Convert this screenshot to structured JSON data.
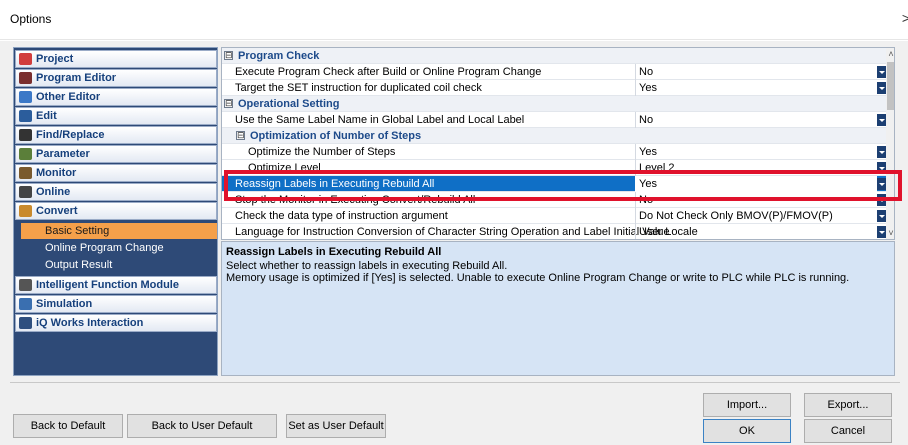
{
  "window": {
    "title": "Options",
    "close_glyph": ">"
  },
  "nav": {
    "items": [
      {
        "label": "Project",
        "icon": "project-icon",
        "color": "#d13d3d"
      },
      {
        "label": "Program Editor",
        "icon": "program-editor-icon",
        "color": "#7a2e2e"
      },
      {
        "label": "Other Editor",
        "icon": "other-editor-icon",
        "color": "#3b78c7"
      },
      {
        "label": "Edit",
        "icon": "scissors-icon",
        "color": "#2b5d9c"
      },
      {
        "label": "Find/Replace",
        "icon": "binoculars-icon",
        "color": "#333333"
      },
      {
        "label": "Parameter",
        "icon": "parameter-icon",
        "color": "#5b7f3a"
      },
      {
        "label": "Monitor",
        "icon": "monitor-icon",
        "color": "#7a5a2e"
      },
      {
        "label": "Online",
        "icon": "online-icon",
        "color": "#444444"
      },
      {
        "label": "Convert",
        "icon": "convert-icon",
        "color": "#c98a2d"
      }
    ],
    "subitems": [
      {
        "label": "Basic Setting"
      },
      {
        "label": "Online Program Change"
      },
      {
        "label": "Output Result"
      }
    ],
    "items_after": [
      {
        "label": "Intelligent Function Module",
        "icon": "intelligent-module-icon",
        "color": "#555555"
      },
      {
        "label": "Simulation",
        "icon": "simulation-icon",
        "color": "#3a6fb0"
      },
      {
        "label": "iQ Works Interaction",
        "icon": "iq-works-icon",
        "color": "#2f4f7f"
      }
    ]
  },
  "grid": {
    "collapse_glyph": "⊟",
    "rows": [
      {
        "type": "cat",
        "name": "Program Check"
      },
      {
        "type": "prop",
        "name": "Execute Program Check after Build or Online Program Change",
        "value": "No",
        "dropdown": true
      },
      {
        "type": "prop",
        "name": "Target the SET instruction for duplicated coil check",
        "value": "Yes",
        "dropdown": true
      },
      {
        "type": "cat",
        "name": "Operational Setting"
      },
      {
        "type": "prop",
        "name": "Use the Same Label Name in Global Label and Local Label",
        "value": "No",
        "dropdown": true
      },
      {
        "type": "subcat",
        "name": "Optimization of Number of Steps"
      },
      {
        "type": "prop2",
        "name": "Optimize the Number of Steps",
        "value": "Yes",
        "dropdown": true
      },
      {
        "type": "prop2",
        "name": "Optimize Level",
        "value": "Level 2",
        "dropdown": true
      },
      {
        "type": "sel",
        "name": "Reassign Labels in Executing Rebuild All",
        "value": "Yes",
        "dropdown": true
      },
      {
        "type": "prop",
        "name": "Stop the Monitor in Executing Convert/Rebuild All",
        "value": "No",
        "dropdown": true
      },
      {
        "type": "prop",
        "name": "Check the data type of instruction argument",
        "value": "Do Not Check Only BMOV(P)/FMOV(P)",
        "dropdown": true
      },
      {
        "type": "prop",
        "name": "Language for Instruction Conversion of Character String Operation and Label Initial Value",
        "value": "User Locale",
        "dropdown": true
      }
    ]
  },
  "description": {
    "title": "Reassign Labels in Executing Rebuild All",
    "line1": "Select whether to reassign labels in executing Rebuild All.",
    "line2": "Memory usage is optimized if [Yes] is selected. Unable to execute Online Program Change or write to PLC while PLC is running."
  },
  "buttons": {
    "back_default": "Back to Default",
    "back_user_default": "Back to User Default",
    "set_user_default": "Set as User Default",
    "import": "Import...",
    "export": "Export...",
    "ok": "OK",
    "cancel": "Cancel"
  }
}
